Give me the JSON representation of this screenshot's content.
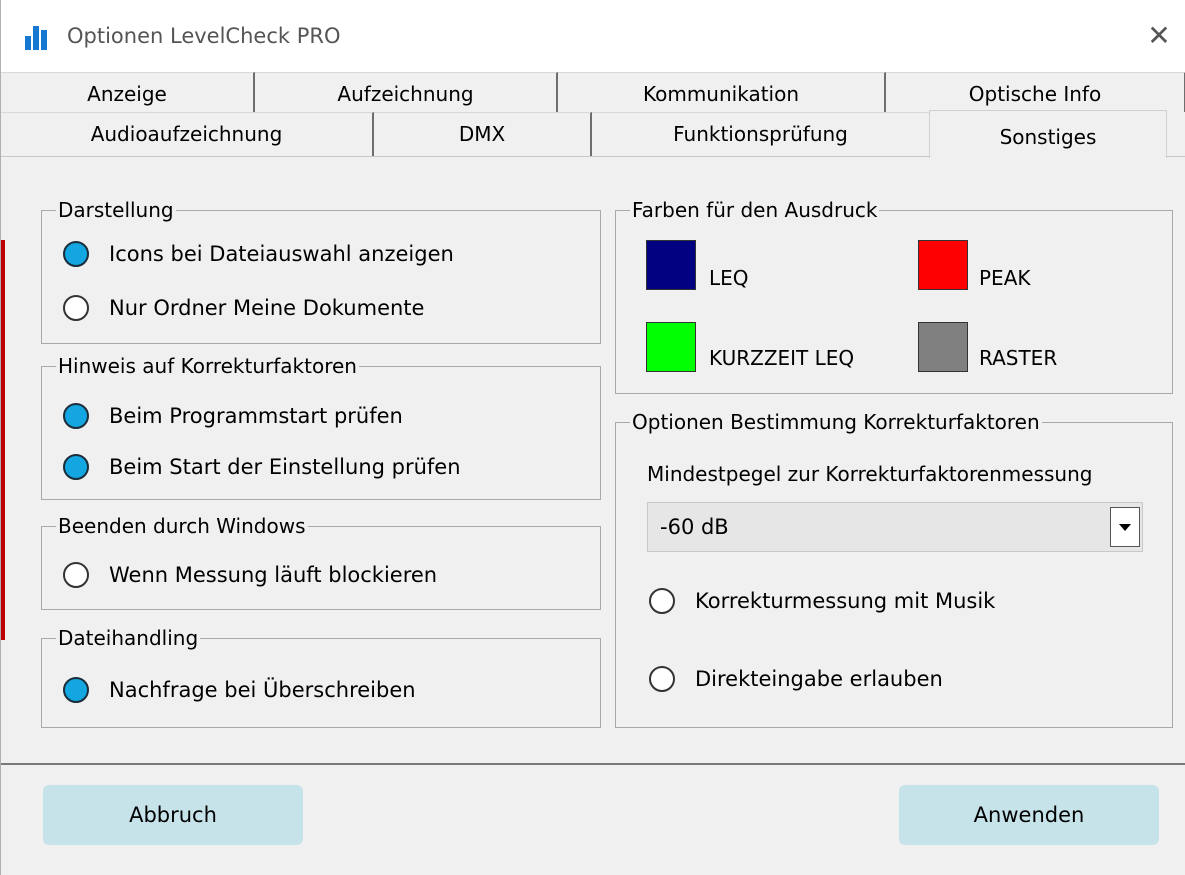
{
  "window": {
    "title": "Optionen LevelCheck PRO",
    "close_symbol": "✕"
  },
  "tabs": {
    "row1": [
      "Anzeige",
      "Aufzeichnung",
      "Kommunikation",
      "Optische Info"
    ],
    "row2": [
      "Audioaufzeichnung",
      "DMX",
      "Funktionsprüfung",
      "Sonstiges"
    ],
    "active": "Sonstiges"
  },
  "groups": {
    "darstellung": {
      "title": "Darstellung",
      "options": [
        {
          "label": "Icons bei Dateiauswahl anzeigen",
          "selected": true
        },
        {
          "label": "Nur Ordner Meine Dokumente",
          "selected": false
        }
      ]
    },
    "hinweis": {
      "title": "Hinweis auf Korrekturfaktoren",
      "options": [
        {
          "label": "Beim Programmstart prüfen",
          "selected": true
        },
        {
          "label": "Beim Start der Einstellung prüfen",
          "selected": true
        }
      ]
    },
    "beenden": {
      "title": "Beenden durch Windows",
      "options": [
        {
          "label": "Wenn Messung läuft blockieren",
          "selected": false
        }
      ]
    },
    "datei": {
      "title": "Dateihandling",
      "options": [
        {
          "label": "Nachfrage bei Überschreiben",
          "selected": true
        }
      ]
    },
    "farben": {
      "title": "Farben für den Ausdruck",
      "swatches": [
        {
          "label": "LEQ",
          "color": "#000080"
        },
        {
          "label": "PEAK",
          "color": "#ff0000"
        },
        {
          "label": "KURZZEIT LEQ",
          "color": "#00ff00"
        },
        {
          "label": "RASTER",
          "color": "#808080"
        }
      ]
    },
    "korrektur": {
      "title": "Optionen Bestimmung Korrekturfaktoren",
      "min_level_label": "Mindestpegel zur Korrekturfaktorenmessung",
      "min_level_value": "-60 dB",
      "options": [
        {
          "label": "Korrekturmessung mit Musik",
          "selected": false
        },
        {
          "label": "Direkteingabe erlauben",
          "selected": false
        }
      ]
    }
  },
  "buttons": {
    "cancel": "Abbruch",
    "apply": "Anwenden"
  },
  "colors": {
    "radio_selected": "#13a6e0",
    "button_bg": "#c7e3ea",
    "app_icon": "#1778d2"
  }
}
